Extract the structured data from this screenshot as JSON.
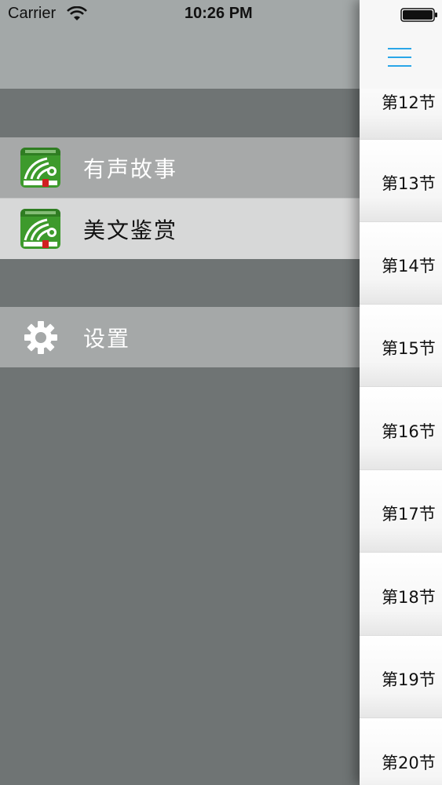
{
  "status_bar": {
    "carrier": "Carrier",
    "time": "10:26 PM"
  },
  "drawer": {
    "items": [
      {
        "label": "有声故事",
        "icon": "book-app-icon"
      },
      {
        "label": "美文鉴赏",
        "icon": "book-app-icon"
      }
    ],
    "settings": {
      "label": "设置",
      "icon": "gear-icon"
    }
  },
  "content": {
    "menu_icon": "hamburger-icon",
    "accent_color": "#2aa6e8",
    "sections": [
      "第12节",
      "第13节",
      "第14节",
      "第15节",
      "第16节",
      "第17节",
      "第18节",
      "第19节",
      "第20节"
    ]
  }
}
